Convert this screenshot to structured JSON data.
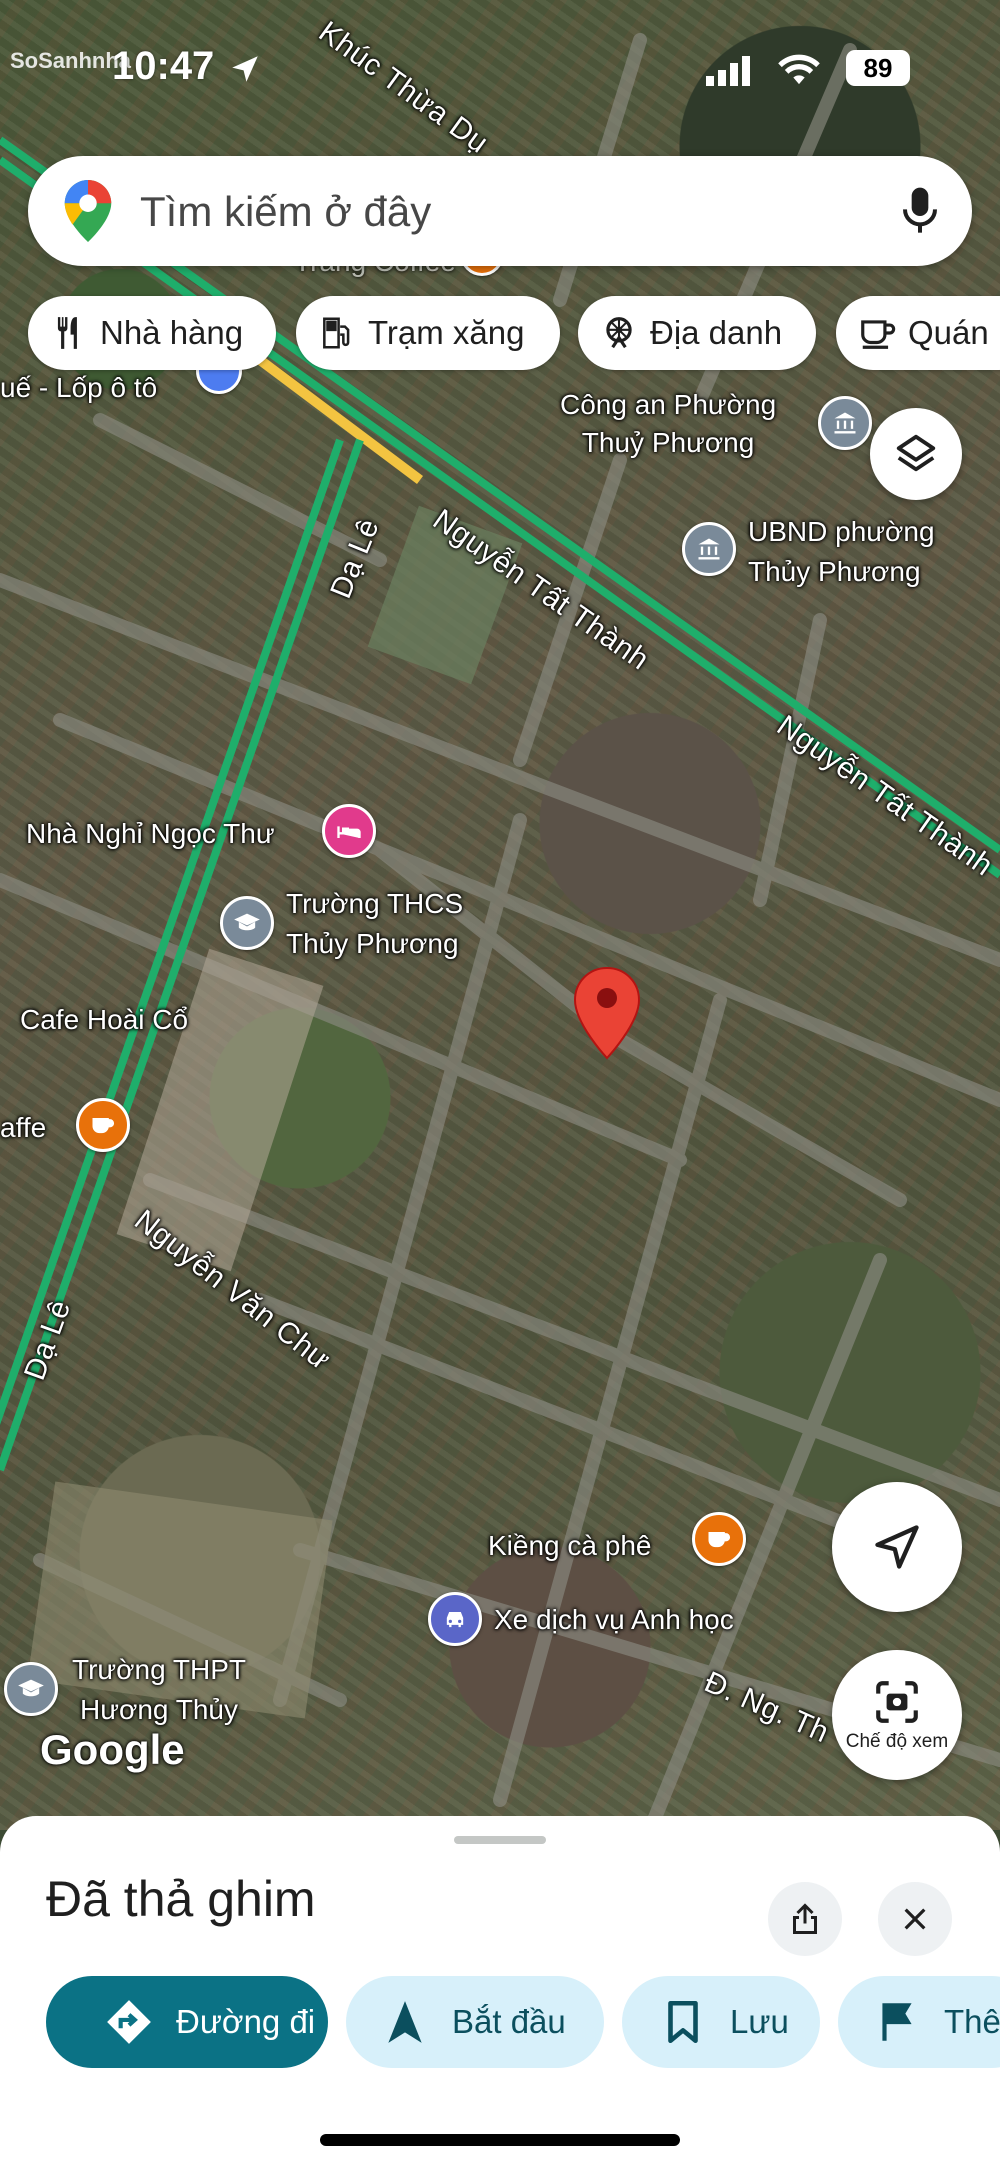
{
  "status_bar": {
    "time": "10:47",
    "battery": "89",
    "watermark": "SoSanhnhà"
  },
  "search": {
    "placeholder": "Tìm kiếm ở đây",
    "mic_icon": "microphone-icon"
  },
  "chips": [
    {
      "label": "Nhà hàng",
      "icon": "restaurant-icon"
    },
    {
      "label": "Trạm xăng",
      "icon": "gas-station-icon"
    },
    {
      "label": "Địa danh",
      "icon": "landmark-icon"
    },
    {
      "label": "Quán",
      "icon": "coffee-icon"
    }
  ],
  "map": {
    "labels": {
      "khuc_thua_du": "Khúc Thừa Dụ",
      "lop_o_to": "uế - Lốp ô tô",
      "cong_an": "Công an Phường\nThuỷ Phương",
      "ubnd": "UBND phường\nThủy Phương",
      "nha_nghi": "Nhà Nghỉ Ngọc Thư",
      "truong_thcs": "Trường THCS\nThủy Phương",
      "cafe_hoai_co": "Cafe Hoài Cổ",
      "caffe": "affe",
      "kieng_ca_phe": "Kiềng cà phê",
      "xe_dich_vu": "Xe dịch vụ Anh học",
      "truong_thpt": "Trường THPT\nHương Thủy",
      "trang_coffee": "Trang Coffee"
    },
    "roads": {
      "da_le_1": "Dạ Lê",
      "da_le_2": "Dạ Lê",
      "nguyen_tat_thanh_1": "Nguyễn Tất Thành",
      "nguyen_tat_thanh_2": "Nguyễn Tất Thành",
      "nguyen_van_chu": "Nguyễn Văn Chư",
      "dng_th": "Đ. Ng. Th"
    },
    "google_logo": "Google",
    "view_mode_label": "Chế độ xem",
    "colors": {
      "pin": "#ea4335",
      "major_road": "#1fae6b",
      "yellow_road": "#f3c441",
      "poi_orange": "#e8710a",
      "poi_pink": "#e13a8c",
      "poi_gray": "#7a8a99",
      "poi_blue_purple": "#5a66c8",
      "action_primary": "#0b7285",
      "action_secondary": "#d7f0fa"
    }
  },
  "sheet": {
    "title": "Đã thả ghim",
    "actions": [
      {
        "label": "Đường đi",
        "icon": "directions-icon"
      },
      {
        "label": "Bắt đầu",
        "icon": "navigation-arrow-icon"
      },
      {
        "label": "Lưu",
        "icon": "bookmark-icon"
      },
      {
        "label": "Thê",
        "icon": "flag-icon"
      }
    ]
  }
}
